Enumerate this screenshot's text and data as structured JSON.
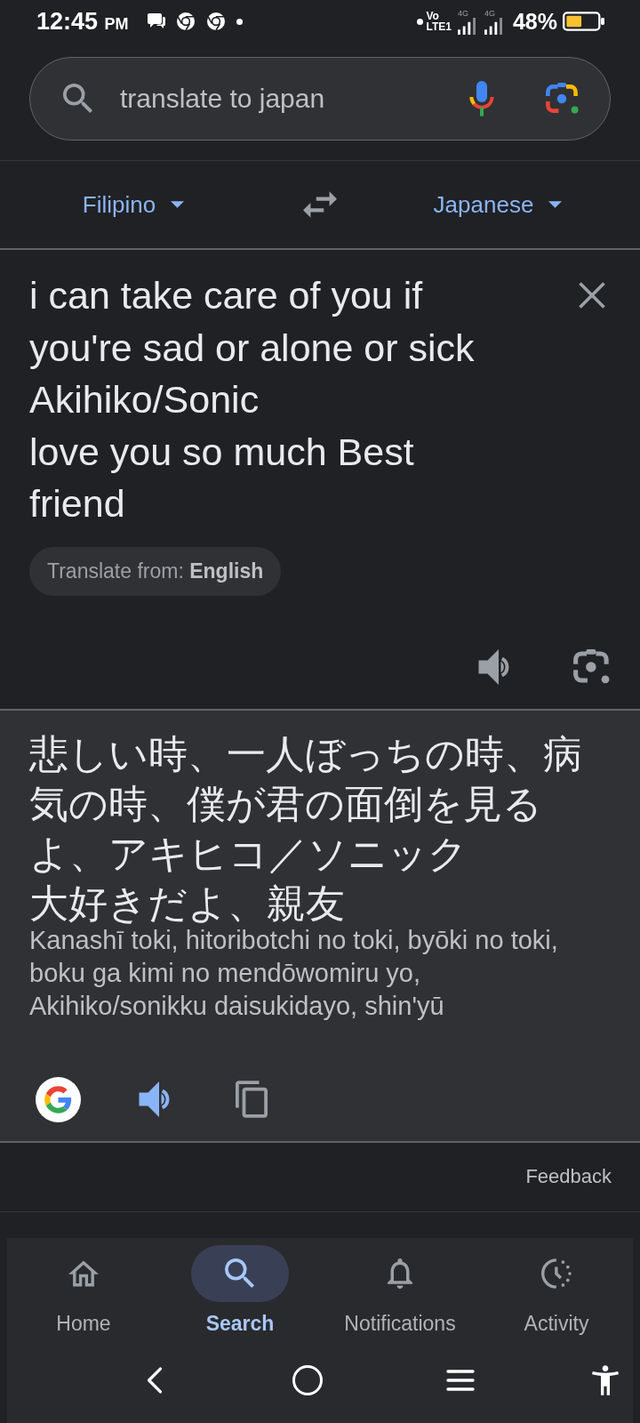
{
  "status_bar": {
    "time": "12:45",
    "meridiem": "PM",
    "volte_top": "Vo",
    "volte_bottom": "LTE1",
    "signals": [
      {
        "label": "4G"
      },
      {
        "label": "4G"
      }
    ],
    "battery_text": "48%"
  },
  "search": {
    "value": "translate to japan"
  },
  "languages": {
    "source": "Filipino",
    "target": "Japanese"
  },
  "input": {
    "text": "i can take care of you if\nyou're sad or alone or sick\nAkihiko/Sonic\nlove you so much Best\nfriend",
    "detected": "Translate from: **English**"
  },
  "output": {
    "lines": [
      "悲しい時、一人ぼっちの時、病気の時、僕が君の面倒を見るよ、アキヒコ／ソニック",
      "大好きだよ、親友"
    ],
    "romanization": "Kanashī toki, hitoribotchi no toki, byōki no toki, boku ga kimi no mendōwomiru yo, Akihiko/sonikku daisukidayo, shin'yū"
  },
  "feedback": "Feedback",
  "bottom_nav": [
    {
      "kind": "home",
      "label": "Home",
      "selected": false
    },
    {
      "kind": "search",
      "label": "Search",
      "selected": true
    },
    {
      "kind": "notifications",
      "label": "Notifications",
      "selected": false
    },
    {
      "kind": "activity",
      "label": "Activity",
      "selected": false
    }
  ]
}
